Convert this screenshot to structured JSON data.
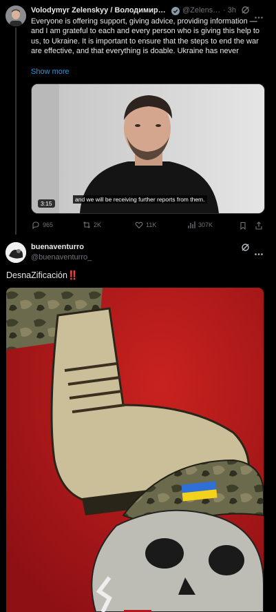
{
  "tweet1": {
    "author_name": "Volodymyr Zelenskyy / Володимир…",
    "handle": "@Zelens…",
    "time": "· 3h",
    "text": "Everyone is offering support, giving advice, providing information — and I am grateful to each and every person who is giving this help to us, to Ukraine. It is important to ensure that the steps to end the war are effective, and that everything is doable. Ukraine has never",
    "show_more": "Show more",
    "video": {
      "caption": "and we will be receiving further reports from them.",
      "duration": "3:15"
    },
    "actions": {
      "replies": "965",
      "reposts": "2K",
      "likes": "11K",
      "views": "307K"
    }
  },
  "tweet2": {
    "author_name": "buenaventurro",
    "handle": "@buenaventurro_",
    "text": "DesnaZificación",
    "emoji": "‼️"
  },
  "colors": {
    "background": "#000000",
    "text": "#e7e9ea",
    "muted": "#71767b",
    "link": "#1d9bf0",
    "verified": "#8b98a5",
    "art_red": "#b5171c"
  },
  "icons": [
    "verified-badge-icon",
    "grok-icon",
    "more-icon",
    "reply-icon",
    "repost-icon",
    "like-icon",
    "views-icon",
    "bookmark-icon",
    "share-icon"
  ]
}
